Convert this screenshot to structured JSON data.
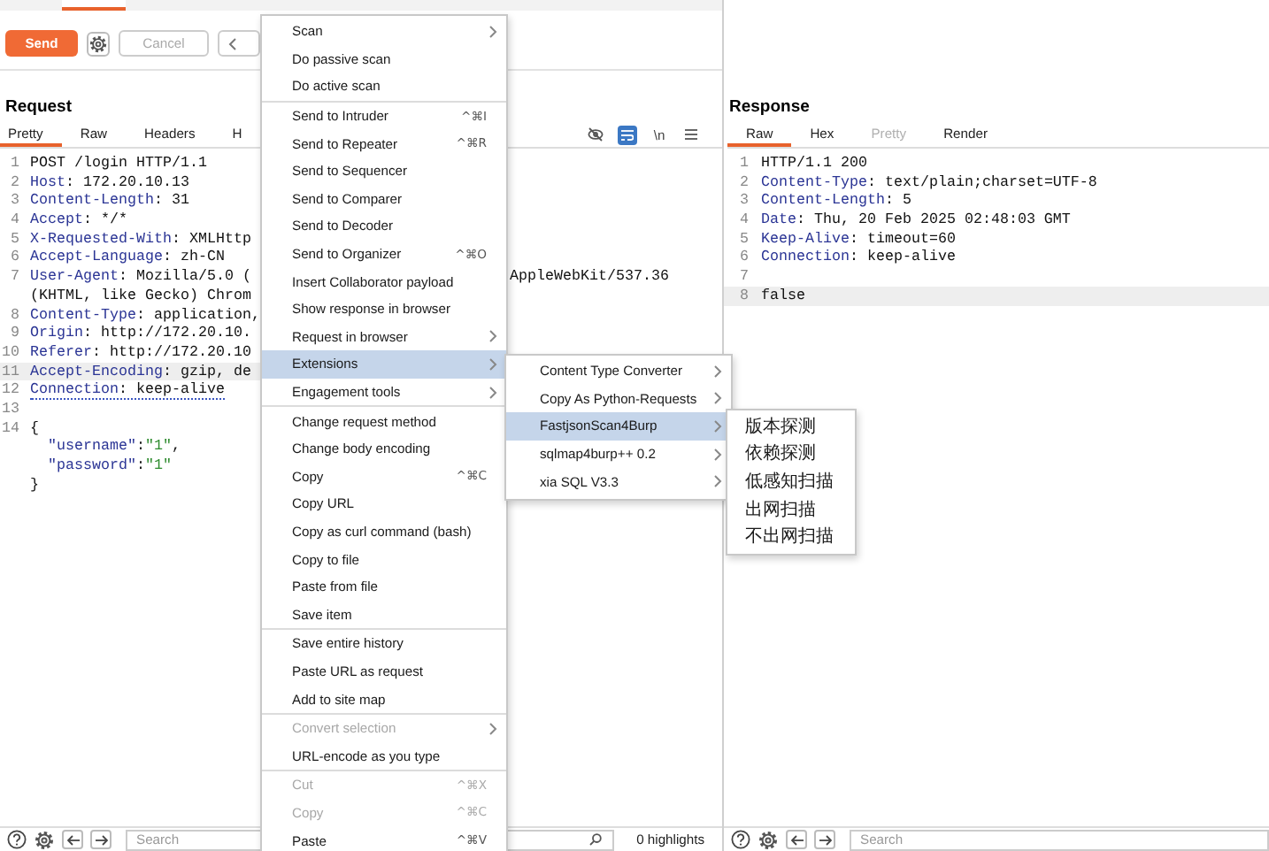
{
  "toolbar": {
    "send": "Send",
    "cancel": "Cancel",
    "cancel_disabled": true
  },
  "request": {
    "title": "Request",
    "tabs": [
      {
        "label": "Pretty",
        "selected": true,
        "disabled": false
      },
      {
        "label": "Raw",
        "selected": false,
        "disabled": false
      },
      {
        "label": "Headers",
        "selected": false,
        "disabled": false
      },
      {
        "label": "H",
        "selected": false,
        "disabled": false
      }
    ],
    "view_buttons": [
      {
        "kind": "hide",
        "on": false
      },
      {
        "kind": "wrap",
        "on": true
      },
      {
        "kind": "text",
        "label": "\\n",
        "on": false
      },
      {
        "kind": "menu",
        "on": false
      }
    ],
    "lines": [
      {
        "number": "1",
        "parts": [
          {
            "kind": "plain",
            "text": "POST /login HTTP/1.1"
          }
        ],
        "highlighted": false
      },
      {
        "number": "2",
        "parts": [
          {
            "kind": "key",
            "text": "Host"
          },
          {
            "kind": "plain",
            "text": ": 172.20.10.13"
          }
        ],
        "highlighted": false
      },
      {
        "number": "3",
        "parts": [
          {
            "kind": "key",
            "text": "Content-Length"
          },
          {
            "kind": "plain",
            "text": ": 31"
          }
        ],
        "highlighted": false
      },
      {
        "number": "4",
        "parts": [
          {
            "kind": "key",
            "text": "Accept"
          },
          {
            "kind": "plain",
            "text": ": */*"
          }
        ],
        "highlighted": false
      },
      {
        "number": "5",
        "parts": [
          {
            "kind": "key",
            "text": "X-Requested-With"
          },
          {
            "kind": "plain",
            "text": ": XMLHttp"
          }
        ],
        "highlighted": false
      },
      {
        "number": "6",
        "parts": [
          {
            "kind": "key",
            "text": "Accept-Language"
          },
          {
            "kind": "plain",
            "text": ": zh-CN"
          }
        ],
        "highlighted": false
      },
      {
        "number": "7",
        "parts": [
          {
            "kind": "key",
            "text": "User-Agent"
          },
          {
            "kind": "plain",
            "text": ": Mozilla/5.0 ("
          }
        ],
        "after": "AppleWebKit/537.36",
        "highlighted": false
      },
      {
        "parts": [
          {
            "kind": "plain",
            "text": "(KHTML, like Gecko) Chrom"
          }
        ],
        "highlighted": false
      },
      {
        "number": "8",
        "parts": [
          {
            "kind": "key",
            "text": "Content-Type"
          },
          {
            "kind": "plain",
            "text": ": application,"
          }
        ],
        "highlighted": false
      },
      {
        "number": "9",
        "parts": [
          {
            "kind": "key",
            "text": "Origin"
          },
          {
            "kind": "plain",
            "text": ": http://172.20.10."
          }
        ],
        "highlighted": false
      },
      {
        "number": "10",
        "parts": [
          {
            "kind": "key",
            "text": "Referer"
          },
          {
            "kind": "plain",
            "text": ": http://172.20.10"
          }
        ],
        "highlighted": false
      },
      {
        "number": "11",
        "parts": [
          {
            "kind": "key",
            "text": "Accept-Encoding"
          },
          {
            "kind": "plain",
            "text": ": gzip, de"
          }
        ],
        "highlighted": true
      },
      {
        "number": "12",
        "parts": [
          {
            "kind": "key",
            "text": "Connection"
          },
          {
            "kind": "plain",
            "text": ": keep-alive"
          }
        ],
        "highlighted": false,
        "underlined": true
      },
      {
        "number": "13",
        "highlighted": false
      },
      {
        "number": "14",
        "parts": [
          {
            "kind": "plain",
            "text": "{"
          }
        ],
        "highlighted": false
      },
      {
        "parts": [
          {
            "kind": "key",
            "text": "\"username\""
          },
          {
            "kind": "plain",
            "text": ":"
          },
          {
            "kind": "string",
            "text": "\"1\""
          },
          {
            "kind": "plain",
            "text": ","
          }
        ],
        "highlighted": false,
        "indented": true
      },
      {
        "parts": [
          {
            "kind": "key",
            "text": "\"password\""
          },
          {
            "kind": "plain",
            "text": ":"
          },
          {
            "kind": "string",
            "text": "\"1\""
          }
        ],
        "highlighted": false,
        "indented": true
      },
      {
        "parts": [
          {
            "kind": "plain",
            "text": "}"
          }
        ],
        "highlighted": false
      }
    ],
    "search": {
      "placeholder": "Search"
    },
    "highlights": "0 highlights"
  },
  "response": {
    "title": "Response",
    "tabs": [
      {
        "label": "Raw",
        "selected": true,
        "disabled": false
      },
      {
        "label": "Hex",
        "selected": false,
        "disabled": false
      },
      {
        "label": "Pretty",
        "selected": false,
        "disabled": true
      },
      {
        "label": "Render",
        "selected": false,
        "disabled": false
      }
    ],
    "lines": [
      {
        "number": "1",
        "parts": [
          {
            "kind": "plain",
            "text": "HTTP/1.1 200"
          }
        ],
        "highlighted": false
      },
      {
        "number": "2",
        "parts": [
          {
            "kind": "key",
            "text": "Content-Type"
          },
          {
            "kind": "plain",
            "text": ": text/plain;charset=UTF-8"
          }
        ],
        "highlighted": false
      },
      {
        "number": "3",
        "parts": [
          {
            "kind": "key",
            "text": "Content-Length"
          },
          {
            "kind": "plain",
            "text": ": 5"
          }
        ],
        "highlighted": false
      },
      {
        "number": "4",
        "parts": [
          {
            "kind": "key",
            "text": "Date"
          },
          {
            "kind": "plain",
            "text": ": Thu, 20 Feb 2025 02:48:03 GMT"
          }
        ],
        "highlighted": false
      },
      {
        "number": "5",
        "parts": [
          {
            "kind": "key",
            "text": "Keep-Alive"
          },
          {
            "kind": "plain",
            "text": ": timeout=60"
          }
        ],
        "highlighted": false
      },
      {
        "number": "6",
        "parts": [
          {
            "kind": "key",
            "text": "Connection"
          },
          {
            "kind": "plain",
            "text": ": keep-alive"
          }
        ],
        "highlighted": false
      },
      {
        "number": "7",
        "highlighted": false
      },
      {
        "number": "8",
        "parts": [
          {
            "kind": "plain",
            "text": "false"
          }
        ],
        "highlighted": true
      }
    ],
    "search": {
      "placeholder": "Search"
    }
  },
  "context_menu": {
    "groups": [
      [
        {
          "label": "Scan",
          "submenu": true,
          "selected": false,
          "disabled": false
        },
        {
          "label": "Do passive scan",
          "submenu": false,
          "selected": false,
          "disabled": false
        },
        {
          "label": "Do active scan",
          "submenu": false,
          "selected": false,
          "disabled": false
        }
      ],
      [
        {
          "label": "Send to Intruder",
          "shortcut": "^⌘I",
          "submenu": false,
          "selected": false,
          "disabled": false
        },
        {
          "label": "Send to Repeater",
          "shortcut": "^⌘R",
          "submenu": false,
          "selected": false,
          "disabled": false
        },
        {
          "label": "Send to Sequencer",
          "submenu": false,
          "selected": false,
          "disabled": false
        },
        {
          "label": "Send to Comparer",
          "submenu": false,
          "selected": false,
          "disabled": false
        },
        {
          "label": "Send to Decoder",
          "submenu": false,
          "selected": false,
          "disabled": false
        },
        {
          "label": "Send to Organizer",
          "shortcut": "^⌘O",
          "submenu": false,
          "selected": false,
          "disabled": false
        },
        {
          "label": "Insert Collaborator payload",
          "submenu": false,
          "selected": false,
          "disabled": false
        },
        {
          "label": "Show response in browser",
          "submenu": false,
          "selected": false,
          "disabled": false
        },
        {
          "label": "Request in browser",
          "submenu": true,
          "selected": false,
          "disabled": false
        },
        {
          "label": "Extensions",
          "submenu": true,
          "selected": true,
          "disabled": false
        },
        {
          "label": "Engagement tools",
          "submenu": true,
          "selected": false,
          "disabled": false
        }
      ],
      [
        {
          "label": "Change request method",
          "submenu": false,
          "selected": false,
          "disabled": false
        },
        {
          "label": "Change body encoding",
          "submenu": false,
          "selected": false,
          "disabled": false
        },
        {
          "label": "Copy",
          "shortcut": "^⌘C",
          "submenu": false,
          "selected": false,
          "disabled": false
        },
        {
          "label": "Copy URL",
          "submenu": false,
          "selected": false,
          "disabled": false
        },
        {
          "label": "Copy as curl command (bash)",
          "submenu": false,
          "selected": false,
          "disabled": false
        },
        {
          "label": "Copy to file",
          "submenu": false,
          "selected": false,
          "disabled": false
        },
        {
          "label": "Paste from file",
          "submenu": false,
          "selected": false,
          "disabled": false
        },
        {
          "label": "Save item",
          "submenu": false,
          "selected": false,
          "disabled": false
        }
      ],
      [
        {
          "label": "Save entire history",
          "submenu": false,
          "selected": false,
          "disabled": false
        },
        {
          "label": "Paste URL as request",
          "submenu": false,
          "selected": false,
          "disabled": false
        },
        {
          "label": "Add to site map",
          "submenu": false,
          "selected": false,
          "disabled": false
        }
      ],
      [
        {
          "label": "Convert selection",
          "submenu": true,
          "selected": false,
          "disabled": true
        },
        {
          "label": "URL-encode as you type",
          "submenu": false,
          "selected": false,
          "disabled": false
        }
      ],
      [
        {
          "label": "Cut",
          "shortcut": "^⌘X",
          "submenu": false,
          "selected": false,
          "disabled": true
        },
        {
          "label": "Copy",
          "shortcut": "^⌘C",
          "submenu": false,
          "selected": false,
          "disabled": true
        },
        {
          "label": "Paste",
          "shortcut": "^⌘V",
          "submenu": false,
          "selected": false,
          "disabled": false
        }
      ]
    ]
  },
  "extensions_menu": {
    "groups": [
      [
        {
          "label": "Content Type Converter",
          "submenu": true,
          "selected": false,
          "disabled": false
        },
        {
          "label": "Copy As Python-Requests",
          "submenu": true,
          "selected": false,
          "disabled": false
        },
        {
          "label": "FastjsonScan4Burp",
          "submenu": true,
          "selected": true,
          "disabled": false
        },
        {
          "label": "sqlmap4burp++ 0.2",
          "submenu": true,
          "selected": false,
          "disabled": false
        },
        {
          "label": "xia SQL V3.3",
          "submenu": true,
          "selected": false,
          "disabled": false
        }
      ]
    ]
  },
  "fastjson_menu": {
    "groups": [
      [
        {
          "label": "版本探测",
          "submenu": false,
          "selected": false,
          "disabled": false
        },
        {
          "label": "依赖探测",
          "submenu": false,
          "selected": false,
          "disabled": false
        },
        {
          "label": "低感知扫描",
          "submenu": false,
          "selected": false,
          "disabled": false
        },
        {
          "label": "出网扫描",
          "submenu": false,
          "selected": false,
          "disabled": false
        },
        {
          "label": "不出网扫描",
          "submenu": false,
          "selected": false,
          "disabled": false
        }
      ]
    ]
  }
}
